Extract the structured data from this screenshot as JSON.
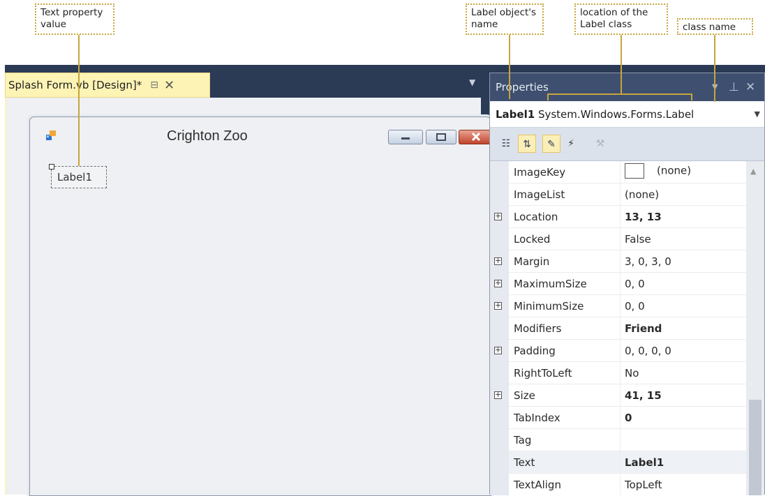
{
  "callouts": {
    "text_property_value": "Text property\nvalue",
    "label_object_name": "Label object's\nname",
    "label_class_location": "location of the\nLabel class",
    "class_name": "class name"
  },
  "designer": {
    "tab_label": "Splash Form.vb [Design]*",
    "form_title": "Crighton Zoo",
    "label_text": "Label1"
  },
  "properties": {
    "title": "Properties",
    "object_name": "Label1",
    "object_type": "System.Windows.Forms.Label",
    "rows": [
      {
        "name": "ImageKey",
        "value": "(none)",
        "bold": false,
        "expandable": false
      },
      {
        "name": "ImageList",
        "value": "(none)",
        "bold": false,
        "expandable": false
      },
      {
        "name": "Location",
        "value": "13, 13",
        "bold": true,
        "expandable": true
      },
      {
        "name": "Locked",
        "value": "False",
        "bold": false,
        "expandable": false
      },
      {
        "name": "Margin",
        "value": "3, 0, 3, 0",
        "bold": false,
        "expandable": true
      },
      {
        "name": "MaximumSize",
        "value": "0, 0",
        "bold": false,
        "expandable": true
      },
      {
        "name": "MinimumSize",
        "value": "0, 0",
        "bold": false,
        "expandable": true
      },
      {
        "name": "Modifiers",
        "value": "Friend",
        "bold": true,
        "expandable": false
      },
      {
        "name": "Padding",
        "value": "0, 0, 0, 0",
        "bold": false,
        "expandable": true
      },
      {
        "name": "RightToLeft",
        "value": "No",
        "bold": false,
        "expandable": false
      },
      {
        "name": "Size",
        "value": "41, 15",
        "bold": true,
        "expandable": true
      },
      {
        "name": "TabIndex",
        "value": "0",
        "bold": true,
        "expandable": false
      },
      {
        "name": "Tag",
        "value": "",
        "bold": false,
        "expandable": false
      },
      {
        "name": "Text",
        "value": "Label1",
        "bold": true,
        "expandable": false
      },
      {
        "name": "TextAlign",
        "value": "TopLeft",
        "bold": false,
        "expandable": false
      }
    ]
  },
  "colors": {
    "ide_background": "#2b3a55",
    "active_tab": "#fdf3b5",
    "callout_border": "#c8a53c"
  }
}
